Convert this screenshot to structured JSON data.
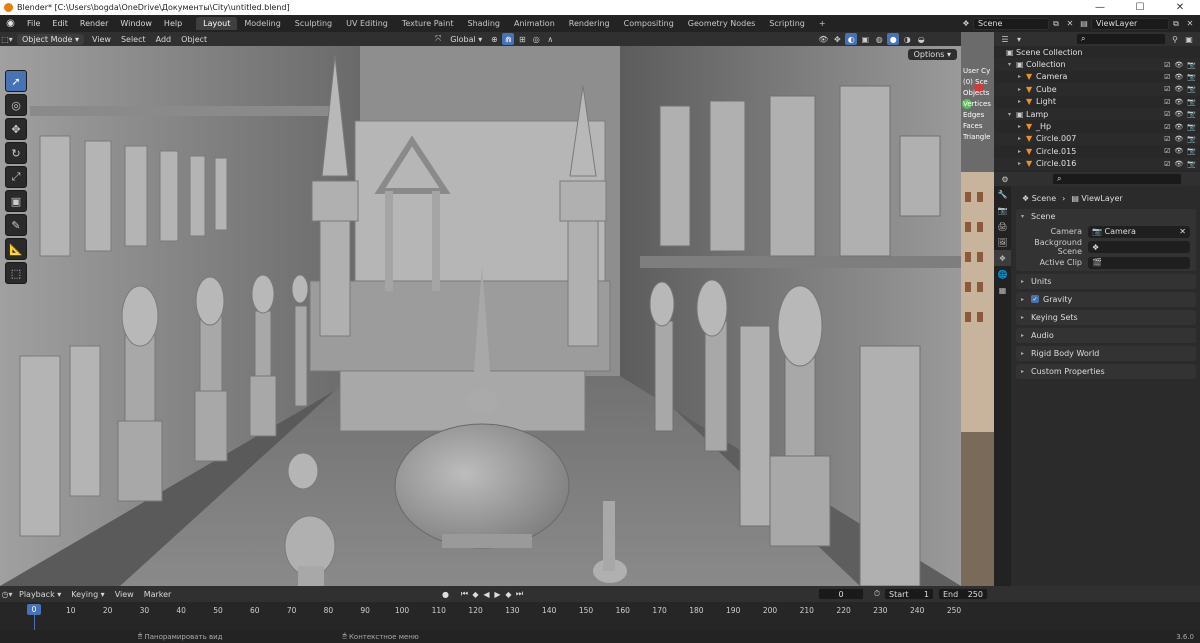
{
  "window": {
    "title": "Blender* [C:\\Users\\bogda\\OneDrive\\Документы\\City\\untitled.blend]",
    "controls": [
      "—",
      "☐",
      "✕"
    ]
  },
  "menu": [
    "File",
    "Edit",
    "Render",
    "Window",
    "Help"
  ],
  "workspaces": [
    {
      "label": "Layout",
      "active": true
    },
    {
      "label": "Modeling",
      "active": false
    },
    {
      "label": "Sculpting",
      "active": false
    },
    {
      "label": "UV Editing",
      "active": false
    },
    {
      "label": "Texture Paint",
      "active": false
    },
    {
      "label": "Shading",
      "active": false
    },
    {
      "label": "Animation",
      "active": false
    },
    {
      "label": "Rendering",
      "active": false
    },
    {
      "label": "Compositing",
      "active": false
    },
    {
      "label": "Geometry Nodes",
      "active": false
    },
    {
      "label": "Scripting",
      "active": false
    }
  ],
  "add_workspace": "+",
  "scene_field": "Scene",
  "viewlayer_field": "ViewLayer",
  "viewport_header": {
    "mode": "Object Mode",
    "menus": [
      "View",
      "Select",
      "Add",
      "Object"
    ],
    "orientation": "Global"
  },
  "viewport": {
    "options": "Options",
    "stats": [
      "User Cy",
      "(0) Sce",
      "Objects",
      "Vertices",
      "Edges",
      "Faces",
      "Triangle"
    ],
    "tools": [
      "select-box",
      "cursor",
      "move",
      "rotate",
      "scale",
      "transform",
      "annotate",
      "measure",
      "add-cube"
    ]
  },
  "outliner": {
    "items": [
      {
        "label": "Scene Collection",
        "indent": 0,
        "icon": "▣",
        "color": "#cfcfcf",
        "expand": ""
      },
      {
        "label": "Collection",
        "indent": 1,
        "icon": "▣",
        "color": "#cfcfcf",
        "expand": "▾"
      },
      {
        "label": "Camera",
        "indent": 2,
        "icon": "▼",
        "color": "#e8922e",
        "expand": "▸"
      },
      {
        "label": "Cube",
        "indent": 2,
        "icon": "▼",
        "color": "#e8922e",
        "expand": "▸"
      },
      {
        "label": "Light",
        "indent": 2,
        "icon": "▼",
        "color": "#e8922e",
        "expand": "▸"
      },
      {
        "label": "Lamp",
        "indent": 1,
        "icon": "▣",
        "color": "#cfcfcf",
        "expand": "▾"
      },
      {
        "label": "_Hp",
        "indent": 2,
        "icon": "▼",
        "color": "#e8922e",
        "expand": "▸"
      },
      {
        "label": "Circle.007",
        "indent": 2,
        "icon": "▼",
        "color": "#e8922e",
        "expand": "▸"
      },
      {
        "label": "Circle.015",
        "indent": 2,
        "icon": "▼",
        "color": "#e8922e",
        "expand": "▸"
      },
      {
        "label": "Circle.016",
        "indent": 2,
        "icon": "▼",
        "color": "#e8922e",
        "expand": "▸"
      }
    ]
  },
  "properties": {
    "breadcrumb": [
      "Scene",
      "ViewLayer"
    ],
    "scene_panel": {
      "title": "Scene",
      "camera_label": "Camera",
      "camera_value": "Camera",
      "bg_scene_label": "Background Scene",
      "active_clip_label": "Active Clip"
    },
    "panels": [
      "Units",
      "Gravity",
      "Keying Sets",
      "Audio",
      "Rigid Body World",
      "Custom Properties"
    ]
  },
  "timeline": {
    "menus": [
      "Playback",
      "Keying",
      "View",
      "Marker"
    ],
    "current_frame": "0",
    "start_label": "Start",
    "start_value": "1",
    "end_label": "End",
    "end_value": "250",
    "ticks": [
      "0",
      "10",
      "20",
      "30",
      "40",
      "50",
      "60",
      "70",
      "80",
      "90",
      "100",
      "110",
      "120",
      "130",
      "140",
      "150",
      "160",
      "170",
      "180",
      "190",
      "200",
      "210",
      "220",
      "230",
      "240",
      "250"
    ]
  },
  "statusbar": {
    "hint1": "Панорамировать вид",
    "hint2": "Контекстное меню",
    "version": "3.6.0"
  },
  "colors": {
    "accent": "#4772b3",
    "blender_orange": "#e87d0d",
    "object_icon": "#e8922e",
    "mesh_icon": "#5fbf5f"
  }
}
